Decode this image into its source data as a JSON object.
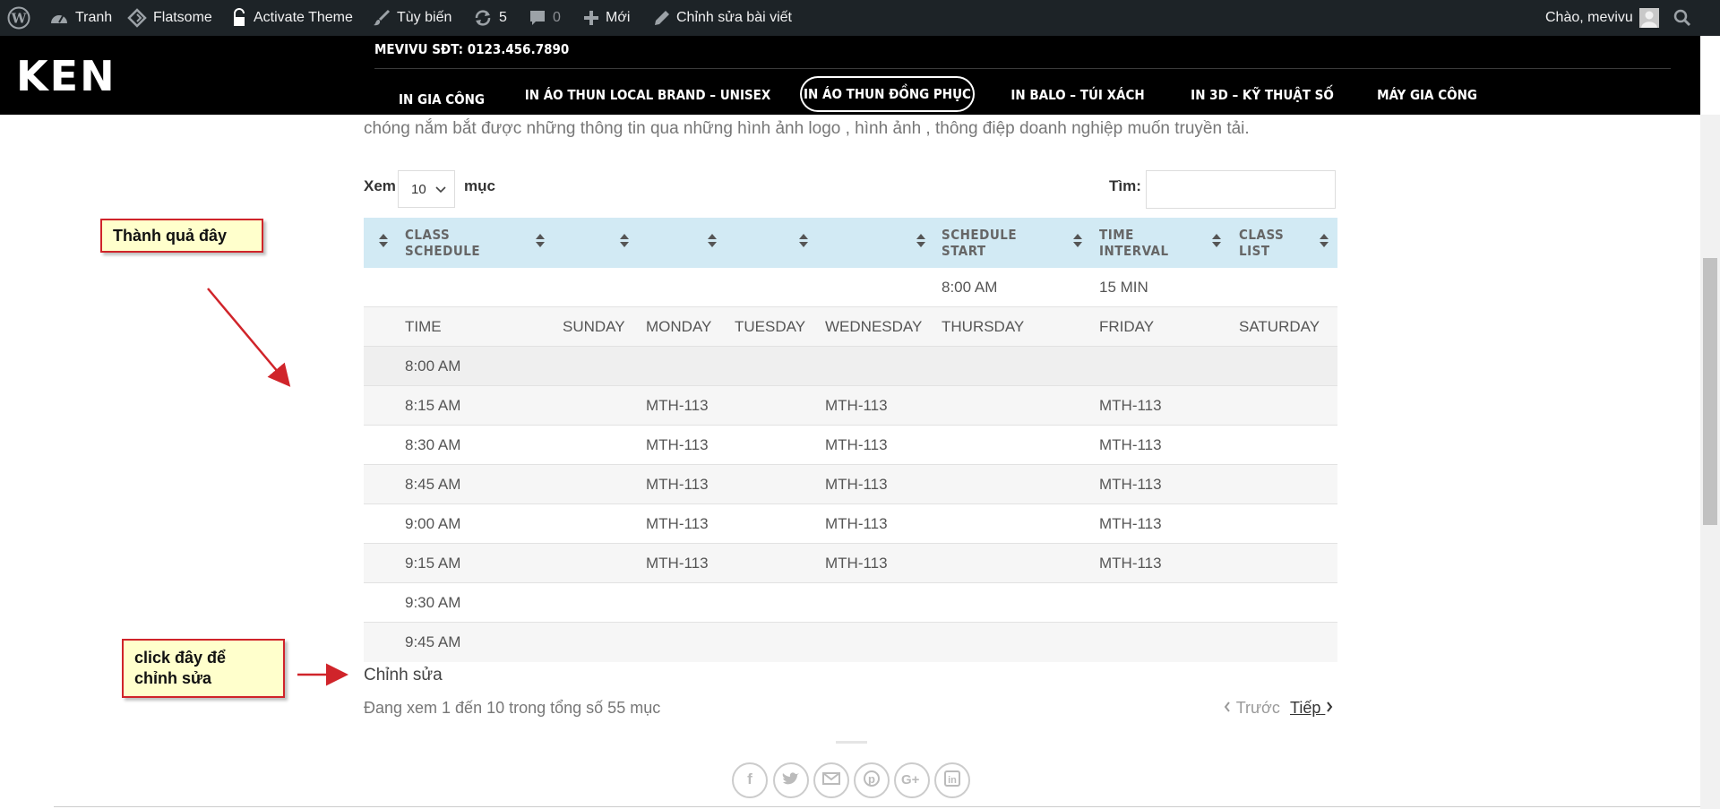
{
  "wpbar": {
    "site_label": "Tranh",
    "theme_label": "Flatsome",
    "activate_label": "Activate Theme",
    "customize_label": "Tùy biến",
    "updates_count": "5",
    "comments_count": "0",
    "new_label": "Mới",
    "edit_post_label": "Chỉnh sửa bài viết",
    "greeting": "Chào, mevivu"
  },
  "header": {
    "logo": "KEN",
    "topline": "MEVIVU SĐT: 0123.456.7890",
    "nav": [
      "IN GIA CÔNG",
      "IN ÁO THUN LOCAL BRAND – UNISEX",
      "IN ÁO THUN ĐỒNG PHỤC",
      "IN BALO – TÚI XÁCH",
      "IN 3D – KỸ THUẬT SỐ",
      "MÁY GIA CÔNG"
    ]
  },
  "content": {
    "intro": "chóng nắm bắt được những thông tin  qua những hình ảnh logo , hình ảnh , thông điệp doanh nghiệp muốn truyền tải.",
    "length_label": "Xem",
    "length_value": "10",
    "length_suffix": "mục",
    "search_label": "Tìm:",
    "edit_link": "Chỉnh sửa",
    "info": "Đang xem 1 đến 10 trong tổng số 55 mục",
    "prev": "Trước",
    "next": "Tiếp"
  },
  "table": {
    "headers": {
      "class_schedule": [
        "CLASS",
        "SCHEDULE"
      ],
      "schedule_start": [
        "SCHEDULE",
        "START"
      ],
      "time_interval": [
        "TIME",
        "INTERVAL"
      ],
      "class_list": [
        "CLASS",
        "LIST"
      ]
    },
    "row1": {
      "start": "8:00 AM",
      "interval": "15 MIN"
    },
    "row2": [
      "TIME",
      "SUNDAY",
      "MONDAY",
      "TUESDAY",
      "WEDNESDAY",
      "THURSDAY",
      "FRIDAY",
      "SATURDAY"
    ],
    "rows": [
      [
        "8:00 AM",
        "",
        "",
        "",
        "",
        "",
        "",
        ""
      ],
      [
        "8:15 AM",
        "",
        "MTH-113",
        "",
        "MTH-113",
        "",
        "MTH-113",
        ""
      ],
      [
        "8:30 AM",
        "",
        "MTH-113",
        "",
        "MTH-113",
        "",
        "MTH-113",
        ""
      ],
      [
        "8:45 AM",
        "",
        "MTH-113",
        "",
        "MTH-113",
        "",
        "MTH-113",
        ""
      ],
      [
        "9:00 AM",
        "",
        "MTH-113",
        "",
        "MTH-113",
        "",
        "MTH-113",
        ""
      ],
      [
        "9:15 AM",
        "",
        "MTH-113",
        "",
        "MTH-113",
        "",
        "MTH-113",
        ""
      ],
      [
        "9:30 AM",
        "",
        "",
        "",
        "",
        "",
        "",
        ""
      ],
      [
        "9:45 AM",
        "",
        "",
        "",
        "",
        "",
        "",
        ""
      ]
    ]
  },
  "annotations": {
    "callout1": "Thành quả đây",
    "callout2": "click đây để chỉnh sửa"
  },
  "colors": {
    "admin_bar": "#1d2327",
    "header": "#000000",
    "table_header": "#d2eaf4",
    "callout_fill": "#ffffcc",
    "callout_border": "#d0242a"
  }
}
